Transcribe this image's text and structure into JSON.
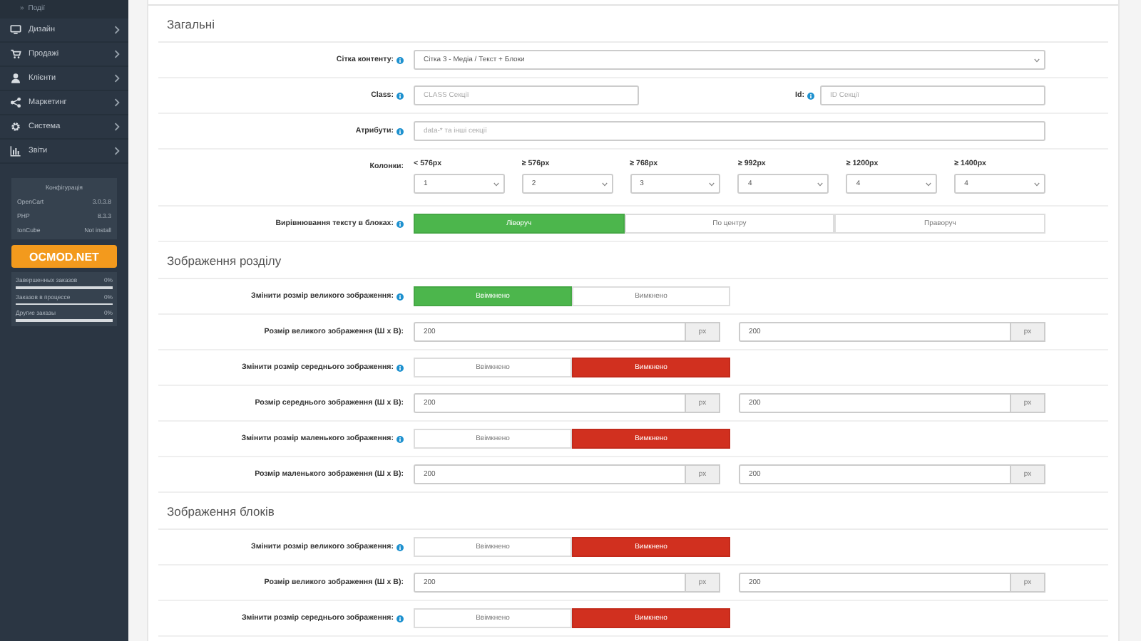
{
  "sidebar": {
    "subitem": {
      "marker": "»",
      "label": "Події"
    },
    "menu": [
      {
        "label": "Дизайн"
      },
      {
        "label": "Продажі"
      },
      {
        "label": "Клієнти"
      },
      {
        "label": "Маркетинг"
      },
      {
        "label": "Система"
      },
      {
        "label": "Звіти"
      }
    ],
    "config": {
      "title": "Конфігурація",
      "rows": [
        {
          "name": "OpenCart",
          "value": "3.0.3.8"
        },
        {
          "name": "PHP",
          "value": "8.3.3"
        },
        {
          "name": "IonCube",
          "value": "Not install"
        }
      ]
    },
    "promo_button": "OCMOD.NET",
    "stats": [
      {
        "label": "Завершенных заказов",
        "value": "0%",
        "level": 0
      },
      {
        "label": "Заказов в процессе",
        "value": "0%",
        "level": 0
      },
      {
        "label": "Другие заказы",
        "value": "0%",
        "level": 0
      }
    ]
  },
  "sections": [
    {
      "title": "Загальні",
      "rows": [
        {
          "kind": "select",
          "label": "Сітка контенту:",
          "help": true,
          "value": "Сітка 3 - Медіа / Текст + Блоки"
        },
        {
          "kind": "pair",
          "fields": [
            {
              "label": "Class:",
              "help": true,
              "placeholder": "CLASS Секції"
            },
            {
              "label": "Id:",
              "help": true,
              "placeholder": "ID Секції"
            }
          ]
        },
        {
          "kind": "input",
          "label": "Атрибути:",
          "help": true,
          "placeholder": "data-* та інші секції"
        },
        {
          "kind": "columns",
          "label": "Колонки:",
          "help": false,
          "columns": [
            {
              "breakpoint": "< 576px",
              "value": "1"
            },
            {
              "breakpoint": "≥ 576px",
              "value": "2"
            },
            {
              "breakpoint": "≥ 768px",
              "value": "3"
            },
            {
              "breakpoint": "≥ 992px",
              "value": "4"
            },
            {
              "breakpoint": "≥ 1200px",
              "value": "4"
            },
            {
              "breakpoint": "≥ 1400px",
              "value": "4"
            }
          ]
        },
        {
          "kind": "alignment",
          "label": "Вирівнювання тексту в блоках:",
          "help": true,
          "options": [
            {
              "label": "Ліворуч",
              "selected": true
            },
            {
              "label": "По центру",
              "selected": false
            },
            {
              "label": "Праворуч",
              "selected": false
            }
          ]
        }
      ]
    },
    {
      "title": "Зображення розділу",
      "rows": [
        {
          "kind": "toggle",
          "label": "Змінити розмір великого зображення:",
          "help": true,
          "options": [
            {
              "label": "Ввімкнено",
              "selected": true
            },
            {
              "label": "Вимкнено",
              "selected": false
            }
          ]
        },
        {
          "kind": "size",
          "label": "Розмір великого зображення (Ш х В):",
          "help": false,
          "fields": [
            {
              "value": "200",
              "unit": "px"
            },
            {
              "value": "200",
              "unit": "px"
            }
          ]
        },
        {
          "kind": "toggle",
          "label": "Змінити розмір середнього зображення:",
          "help": true,
          "options": [
            {
              "label": "Ввімкнено",
              "selected": false
            },
            {
              "label": "Вимкнено",
              "selected": true
            }
          ]
        },
        {
          "kind": "size",
          "label": "Розмір середнього зображення (Ш х В):",
          "help": false,
          "fields": [
            {
              "value": "200",
              "unit": "px"
            },
            {
              "value": "200",
              "unit": "px"
            }
          ]
        },
        {
          "kind": "toggle",
          "label": "Змінити розмір маленького зображення:",
          "help": true,
          "options": [
            {
              "label": "Ввімкнено",
              "selected": false
            },
            {
              "label": "Вимкнено",
              "selected": true
            }
          ]
        },
        {
          "kind": "size",
          "label": "Розмір маленького зображення (Ш х В):",
          "help": false,
          "fields": [
            {
              "value": "200",
              "unit": "px"
            },
            {
              "value": "200",
              "unit": "px"
            }
          ]
        }
      ]
    },
    {
      "title": "Зображення блоків",
      "rows": [
        {
          "kind": "toggle",
          "label": "Змінити розмір великого зображення:",
          "help": true,
          "options": [
            {
              "label": "Ввімкнено",
              "selected": false
            },
            {
              "label": "Вимкнено",
              "selected": true
            }
          ]
        },
        {
          "kind": "size",
          "label": "Розмір великого зображення (Ш х В):",
          "help": false,
          "fields": [
            {
              "value": "200",
              "unit": "px"
            },
            {
              "value": "200",
              "unit": "px"
            }
          ]
        },
        {
          "kind": "toggle",
          "label": "Змінити розмір середнього зображення:",
          "help": true,
          "options": [
            {
              "label": "Ввімкнено",
              "selected": false
            },
            {
              "label": "Вимкнено",
              "selected": true
            }
          ]
        }
      ]
    }
  ]
}
